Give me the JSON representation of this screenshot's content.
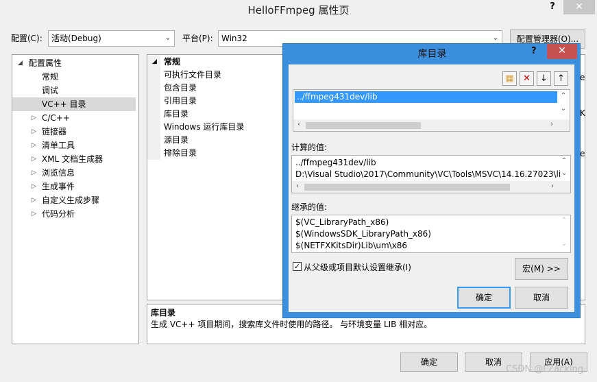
{
  "window": {
    "title": "HelloFFmpeg 属性页",
    "help_glyph": "?",
    "close_glyph": "✕"
  },
  "toolbar": {
    "config_label": "配置(C):",
    "config_value": "活动(Debug)",
    "platform_label": "平台(P):",
    "platform_value": "Win32",
    "config_manager_label": "配置管理器(O)..."
  },
  "tree": {
    "root_label": "配置属性",
    "items": [
      {
        "label": "常规"
      },
      {
        "label": "调试"
      },
      {
        "label": "VC++ 目录"
      },
      {
        "label": "C/C++"
      },
      {
        "label": "链接器"
      },
      {
        "label": "清单工具"
      },
      {
        "label": "XML 文档生成器"
      },
      {
        "label": "浏览信息"
      },
      {
        "label": "生成事件"
      },
      {
        "label": "自定义生成步骤"
      },
      {
        "label": "代码分析"
      }
    ]
  },
  "properties": {
    "category": "常规",
    "rows": [
      {
        "label": "可执行文件目录"
      },
      {
        "label": "包含目录"
      },
      {
        "label": "引用目录"
      },
      {
        "label": "库目录"
      },
      {
        "label": "Windows 运行库目录"
      },
      {
        "label": "源目录"
      },
      {
        "label": "排除目录"
      }
    ],
    "partial_right": [
      "e",
      "K",
      "e"
    ]
  },
  "description": {
    "title": "库目录",
    "text": "生成 VC++ 项目期间，搜索库文件时使用的路径。 与环境变量 LIB 相对应。"
  },
  "bottom_buttons": {
    "ok": "确定",
    "cancel": "取消",
    "apply": "应用(A)"
  },
  "dialog": {
    "title": "库目录",
    "help_glyph": "?",
    "close_glyph": "✕",
    "entries": [
      "../ffmpeg431dev/lib"
    ],
    "computed_label": "计算的值:",
    "computed_lines": [
      "../ffmpeg431dev/lib",
      "D:\\Visual Studio\\2017\\Community\\VC\\Tools\\MSVC\\14.16.27023\\lil"
    ],
    "inherited_label": "继承的值:",
    "inherited_lines": [
      "$(VC_LibraryPath_x86)",
      "$(WindowsSDK_LibraryPath_x86)",
      "$(NETFXKitsDir)Lib\\um\\x86"
    ],
    "inherit_checkbox_label": "从父级或项目默认设置继承(I)",
    "inherit_checked": true,
    "macros_button": "宏(M) >>",
    "ok": "确定",
    "cancel": "取消"
  },
  "watermark": "CSDN @LZacking."
}
